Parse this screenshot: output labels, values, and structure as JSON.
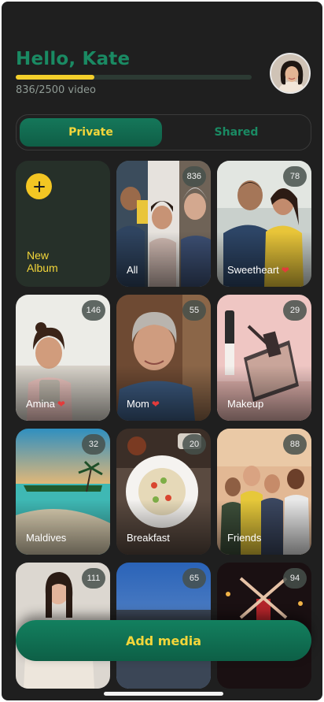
{
  "header": {
    "greeting": "Hello, Kate",
    "progress_text": "836/2500 video",
    "progress_fraction": 0.3344
  },
  "tabs": {
    "private": "Private",
    "shared": "Shared",
    "selected": "Private"
  },
  "new_album": {
    "line1": "New",
    "line2": "Album"
  },
  "albums": [
    {
      "label": "All",
      "count": "836",
      "heart": false
    },
    {
      "label": "Sweetheart",
      "count": "78",
      "heart": true
    },
    {
      "label": "Amina",
      "count": "146",
      "heart": true
    },
    {
      "label": "Mom",
      "count": "55",
      "heart": true
    },
    {
      "label": "Makeup",
      "count": "29",
      "heart": false
    },
    {
      "label": "Maldives",
      "count": "32",
      "heart": false
    },
    {
      "label": "Breakfast",
      "count": "20",
      "heart": false
    },
    {
      "label": "Friends",
      "count": "88",
      "heart": false
    },
    {
      "label": "",
      "count": "111",
      "heart": false
    },
    {
      "label": "",
      "count": "65",
      "heart": false
    },
    {
      "label": "",
      "count": "94",
      "heart": false
    }
  ],
  "icons": {
    "plus": "plus-icon",
    "heart": "heart-icon",
    "avatar": "avatar-photo"
  },
  "colors": {
    "background": "#1f1f1f",
    "accent_green": "#1a8a63",
    "accent_yellow": "#f3d63a",
    "heart_red": "#e33b3b"
  },
  "buttons": {
    "add_media": "Add media"
  }
}
